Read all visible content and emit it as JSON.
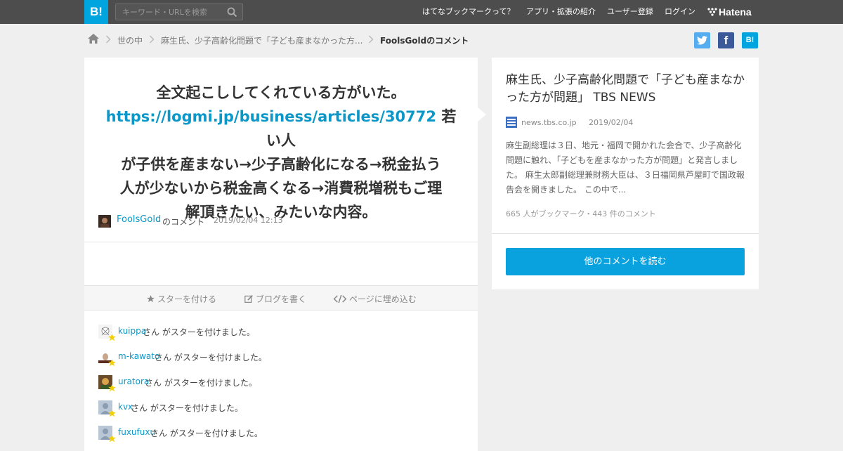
{
  "header": {
    "logo": "B!",
    "search_placeholder": "キーワード・URLを検索",
    "nav": [
      "はてなブックマークって？",
      "アプリ・拡張の紹介",
      "ユーザー登録",
      "ログイン"
    ],
    "brand": "Hatena"
  },
  "breadcrumb": {
    "items": [
      "世の中",
      "麻生氏、少子高齢化問題で「子ども産まなかった方..."
    ],
    "current": "FoolsGoldのコメント"
  },
  "share": {
    "twitter": "t",
    "facebook": "f",
    "hatena": "B!"
  },
  "comment": {
    "line1": "全文起こししてくれている方がいた。",
    "link": "https://logmi.jp/business/articles/30772",
    "line2": " 若い人",
    "line3": "が子供を産まない→少子高齢化になる→税金払う",
    "line4": "人が少ないから税金高くなる→消費税増税もご理",
    "line5": "解頂きたい、みたいな内容。",
    "user": "FoolsGold",
    "suffix": "のコメント",
    "date": "2019/02/04 12:13"
  },
  "actions": {
    "star": "スターを付ける",
    "blog": "ブログを書く",
    "embed": "ページに埋め込む"
  },
  "stars": [
    {
      "user": "kuippa",
      "text": "さん がスターを付けました。"
    },
    {
      "user": "m-kawato",
      "text": "さん がスターを付けました。"
    },
    {
      "user": "uratora",
      "text": "さん がスターを付けました。"
    },
    {
      "user": "kvx",
      "text": "さん がスターを付けました。"
    },
    {
      "user": "fuxufuxu",
      "text": "さん がスターを付けました。"
    }
  ],
  "article": {
    "title": "麻生氏、少子高齢化問題で「子ども産まなかった方が問題」 TBS NEWS",
    "domain": "news.tbs.co.jp",
    "date": "2019/02/04",
    "summary": "麻生副総理は３日、地元・福岡で開かれた会合で、少子高齢化問題に触れ、「子どもを産まなかった方が問題」と発言しました。 麻生太郎副総理兼財務大臣は、３日福岡県芦屋町で国政報告会を開きました。 この中で...",
    "counts": "665 人がブックマーク・443 件のコメント",
    "button": "他のコメントを読む"
  },
  "colors": {
    "accent": "#00a4de",
    "header": "#4d4d4d",
    "link": "#0b98c8",
    "twitter": "#55acee",
    "facebook": "#3b5998"
  }
}
